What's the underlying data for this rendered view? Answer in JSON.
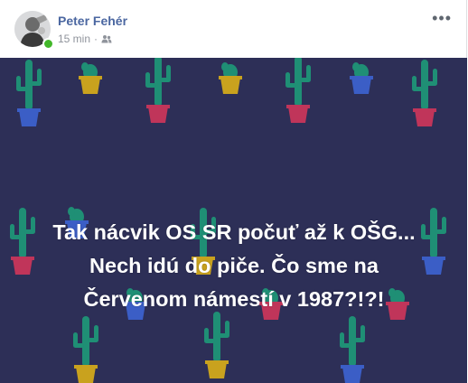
{
  "post": {
    "author": "Peter Fehér",
    "time": "15 min",
    "privacy_icon": "friends-icon",
    "more_icon": "more-options-icon",
    "text": "Tak nácvik OS SR počuť až k OŠG... Nech idú do piče. Čo sme na Červenom námestí v 1987?!?!",
    "online": true
  },
  "colors": {
    "author": "#4b67a1",
    "meta": "#90949c",
    "background": "#2d2f57",
    "cactus": "#1f8f75",
    "online": "#42b72a"
  }
}
